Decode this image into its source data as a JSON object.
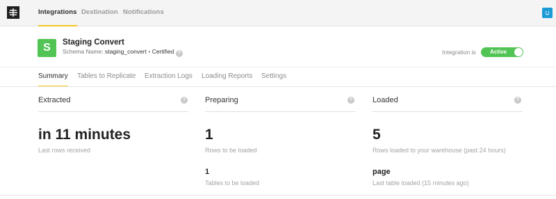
{
  "nav": {
    "tabs": [
      "Integrations",
      "Destination",
      "Notifications"
    ]
  },
  "integration": {
    "icon_letter": "S",
    "title": "Staging Convert",
    "schema_label": "Schema Name:",
    "schema_value": "staging_convert",
    "separator": "•",
    "certified": "Certified",
    "status_label": "Integration is",
    "status_value": "Active"
  },
  "subtabs": [
    "Summary",
    "Tables to Replicate",
    "Extraction Logs",
    "Loading Reports",
    "Settings"
  ],
  "panels": {
    "extracted": {
      "title": "Extracted",
      "value": "in 11 minutes",
      "caption": "Last rows received"
    },
    "preparing": {
      "title": "Preparing",
      "value": "1",
      "caption": "Rows to be loaded",
      "secondary_value": "1",
      "secondary_caption": "Tables to be loaded"
    },
    "loaded": {
      "title": "Loaded",
      "value": "5",
      "caption": "Rows loaded to your warehouse (past 24 hours)",
      "secondary_value": "page",
      "secondary_caption": "Last table loaded (15 minutes ago)"
    }
  },
  "colors": {
    "accent": "#f3c623",
    "active_green": "#52c455",
    "help_blue": "#1d9bd7"
  },
  "icons": {
    "logo": "app-logo-icon",
    "help": "chat-help-icon",
    "question": "question-icon"
  }
}
